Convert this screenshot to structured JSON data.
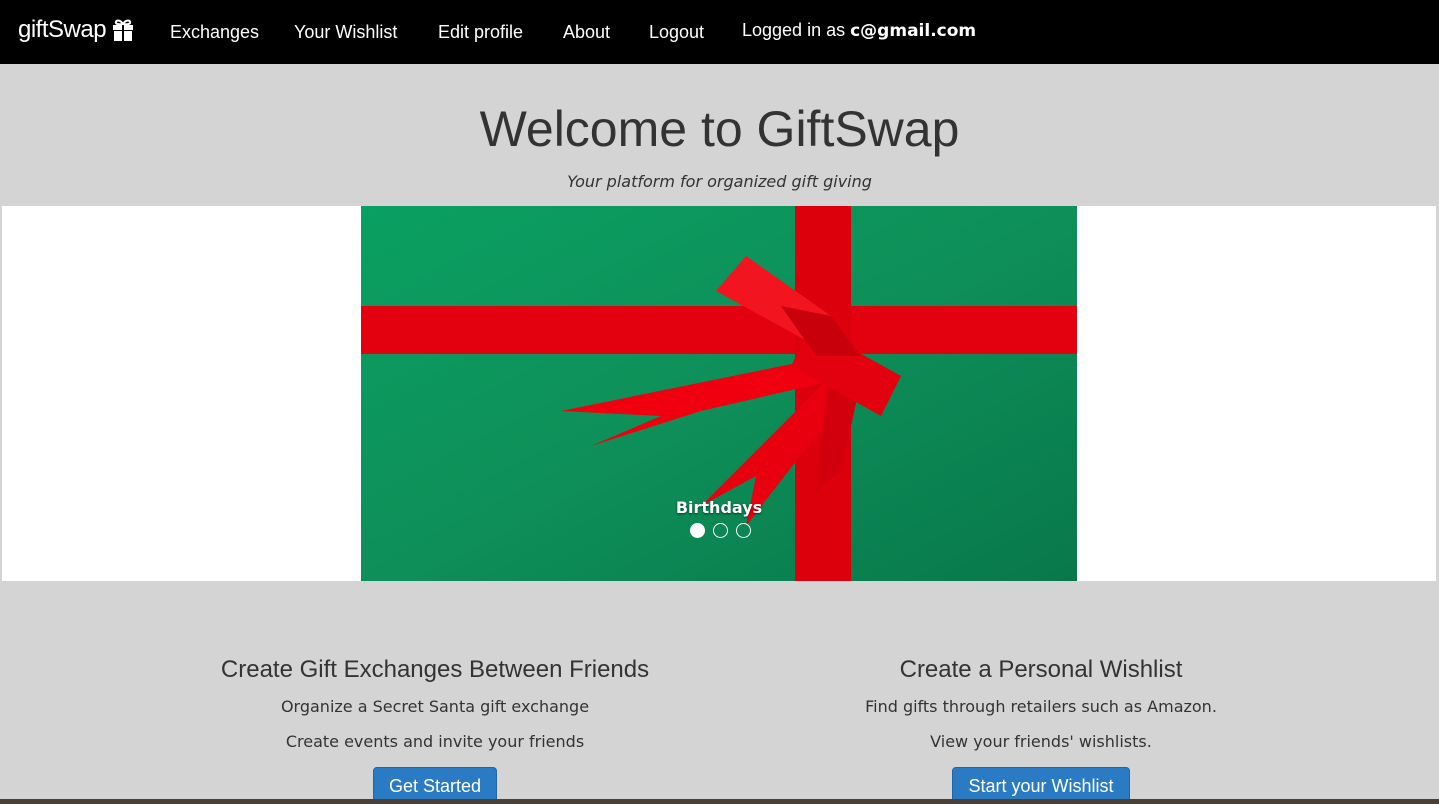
{
  "nav": {
    "brand": "giftSwap",
    "items": [
      {
        "label": "Exchanges"
      },
      {
        "label": "Your Wishlist"
      },
      {
        "label": "Edit profile"
      },
      {
        "label": "About"
      },
      {
        "label": "Logout"
      }
    ],
    "user_prefix": "Logged in as",
    "user_email": "c@gmail.com"
  },
  "hero": {
    "title": "Welcome to GiftSwap",
    "subtitle": "Your platform for organized gift giving"
  },
  "carousel": {
    "caption": "Birthdays",
    "active_index": 0,
    "slide_count": 3,
    "colors": {
      "background": "#0f8a57",
      "ribbon": "#e3000f"
    }
  },
  "features": [
    {
      "title": "Create Gift Exchanges Between Friends",
      "lines": [
        "Organize a Secret Santa gift exchange",
        "Create events and invite your friends"
      ],
      "button": "Get Started"
    },
    {
      "title": "Create a Personal Wishlist",
      "lines": [
        "Find gifts through retailers such as Amazon.",
        "View your friends' wishlists."
      ],
      "button": "Start your Wishlist"
    }
  ],
  "colors": {
    "navbar": "#000000",
    "page_background": "#d4d4d4",
    "button": "#2a7bc4"
  }
}
